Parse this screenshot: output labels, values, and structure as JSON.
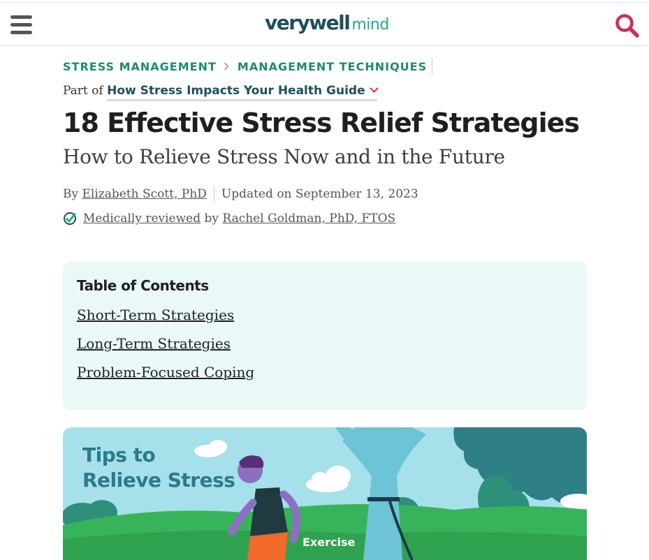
{
  "header": {
    "logo_main": "verywell",
    "logo_sub": "mind"
  },
  "breadcrumb": {
    "items": [
      "STRESS MANAGEMENT",
      "MANAGEMENT TECHNIQUES"
    ]
  },
  "guide": {
    "prefix": "Part of",
    "link": "How Stress Impacts Your Health Guide"
  },
  "article": {
    "title": "18 Effective Stress Relief Strategies",
    "subtitle": "How to Relieve Stress Now and in the Future",
    "by_label": "By",
    "author": "Elizabeth Scott, PhD",
    "updated": "Updated on September 13, 2023",
    "reviewed_label": "Medically reviewed",
    "reviewed_by": "by",
    "reviewer": "Rachel Goldman, PhD, FTOS"
  },
  "toc": {
    "title": "Table of Contents",
    "items": [
      "Short-Term Strategies",
      "Long-Term Strategies",
      "Problem-Focused Coping"
    ]
  },
  "hero": {
    "title_line1": "Tips to",
    "title_line2": "Relieve Stress",
    "label": "Exercise"
  },
  "colors": {
    "brand_dark": "#1d4f5c",
    "brand_green": "#23a987",
    "breadcrumb": "#1f8a6d",
    "accent_red": "#cc2e55",
    "toc_bg": "#eaf8f8"
  },
  "icons": {
    "menu": "hamburger-menu-icon",
    "search": "search-icon",
    "guide_toggle": "chevron-down-icon",
    "breadcrumb_separator": "chevron-right-icon",
    "reviewed": "check-badge-icon"
  }
}
